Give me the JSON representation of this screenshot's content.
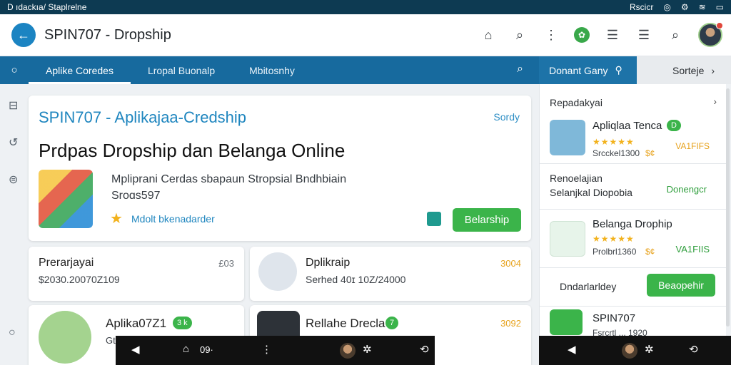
{
  "status_bar": {
    "left": "D  ıdackıa/ Staplrelne",
    "right": "Rscicr"
  },
  "app_bar": {
    "title": "SPIN707 - Dropship"
  },
  "tabs": [
    {
      "label": "Aplike Coredes",
      "active": true
    },
    {
      "label": "Lropal Buonalp",
      "active": false
    },
    {
      "label": "Mbitosnhy",
      "active": false
    }
  ],
  "tab_right_label": "Donant Gany",
  "tab_sort_label": "Sorteje",
  "hero": {
    "subtitle": "SPIN707 - Aplikajaa-Credship",
    "sort_label": "Sordy",
    "title": "Prdpas Dropship dan Belanga Online",
    "description_line1": "Mpliprani Cerdas sbapaun Stropsial Bndhbiain",
    "description_line2": "Sroɑs597",
    "link_label": "Mdolt bkenadarder",
    "button_label": "Belarship"
  },
  "mini_cards": [
    {
      "title": "Prerarjayai",
      "subtitle": "$2030.20070Z109",
      "number": "£03"
    },
    {
      "title": "Dplikraip",
      "subtitle": "Serhed 40ɪ 10Z/24000",
      "number": "3004"
    }
  ],
  "bottom_cards": [
    {
      "title": "Aplika07Z1",
      "badge": "3 k",
      "subtitle": "Gt"
    },
    {
      "title": "Rellahe Drecla",
      "badge": "7",
      "subtitle": "",
      "number": "3092"
    }
  ],
  "nav_bar": {
    "time": "09·"
  },
  "sidebar": {
    "section1_title": "Repadakyai",
    "app1": {
      "name": "Apliqlaa Tenca",
      "badge": "D",
      "meta": "Srcckel1300",
      "unit": "$¢",
      "price": "VA1FIFS"
    },
    "section2_title_line1": "Renoelajian",
    "section2_title_line2": "Selanjkal Diopobia",
    "section2_link": "Donengcr",
    "app2": {
      "name": "Belanga Drophip",
      "meta": "Prolbrl1360",
      "unit": "$¢",
      "price": "VA1FIIS"
    },
    "section3_label": "Dndarlarldey",
    "section3_button": "Beaopehir",
    "app3": {
      "name": "SPIN707",
      "meta": "Fsrcrtl ... 1920"
    }
  }
}
